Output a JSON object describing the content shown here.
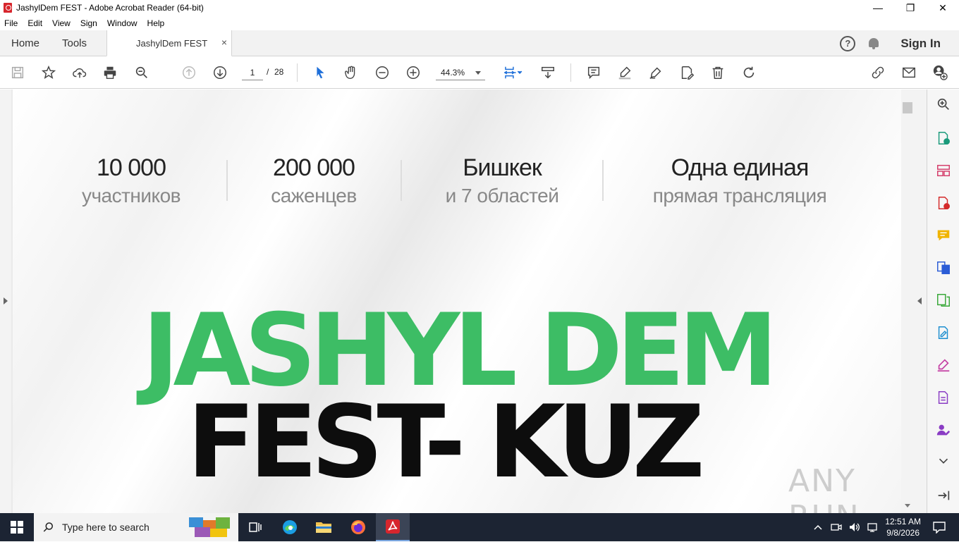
{
  "window": {
    "title": "JashylDem FEST - Adobe Acrobat Reader (64-bit)",
    "controls": {
      "minimize": "—",
      "maximize": "❐",
      "close": "✕"
    }
  },
  "menu": [
    "File",
    "Edit",
    "View",
    "Sign",
    "Window",
    "Help"
  ],
  "tabs": {
    "home": "Home",
    "tools": "Tools",
    "document": "JashylDem FEST",
    "close": "×",
    "help_glyph": "?",
    "sign_in": "Sign In"
  },
  "toolbar": {
    "current_page": "1",
    "page_separator": "/",
    "total_pages": "28",
    "zoom": "44.3%"
  },
  "document": {
    "stats": [
      {
        "value": "10 000",
        "label": "участников"
      },
      {
        "value": "200 000",
        "label": "саженцев"
      },
      {
        "value": "Бишкек",
        "label": "и 7 областей"
      },
      {
        "value": "Одна единая",
        "label": "прямая трансляция"
      }
    ],
    "headline_line1": "JASHYL DEM",
    "headline_line2": "FEST- KUZ",
    "headline_color": "#3dbd65",
    "watermark": "ANY RUN"
  },
  "taskbar": {
    "search_placeholder": "Type here to search",
    "time": "12:51 AM",
    "date": "9/8/2026"
  },
  "icons": {
    "toolbar": [
      "save-icon",
      "bookmark-star-icon",
      "upload-cloud-icon",
      "print-icon",
      "find-zoom-icon",
      "prev-page-icon",
      "next-page-icon",
      "select-cursor-icon",
      "hand-pan-icon",
      "zoom-out-icon",
      "zoom-in-icon",
      "page-fit-icon",
      "scroll-mode-icon",
      "comment-icon",
      "highlight-pen-icon",
      "draw-pen-icon",
      "fill-sign-icon",
      "delete-icon",
      "rotate-icon",
      "share-link-icon",
      "email-icon",
      "add-user-icon"
    ],
    "right_pane": [
      "search-zoom-icon",
      "export-pdf-icon",
      "organize-pages-icon",
      "create-pdf-icon",
      "comment-icon",
      "combine-files-icon",
      "compress-icon",
      "edit-pdf-icon",
      "fill-sign-icon",
      "protect-icon",
      "request-signature-icon",
      "more-tools-icon",
      "expand-pane-icon"
    ]
  }
}
